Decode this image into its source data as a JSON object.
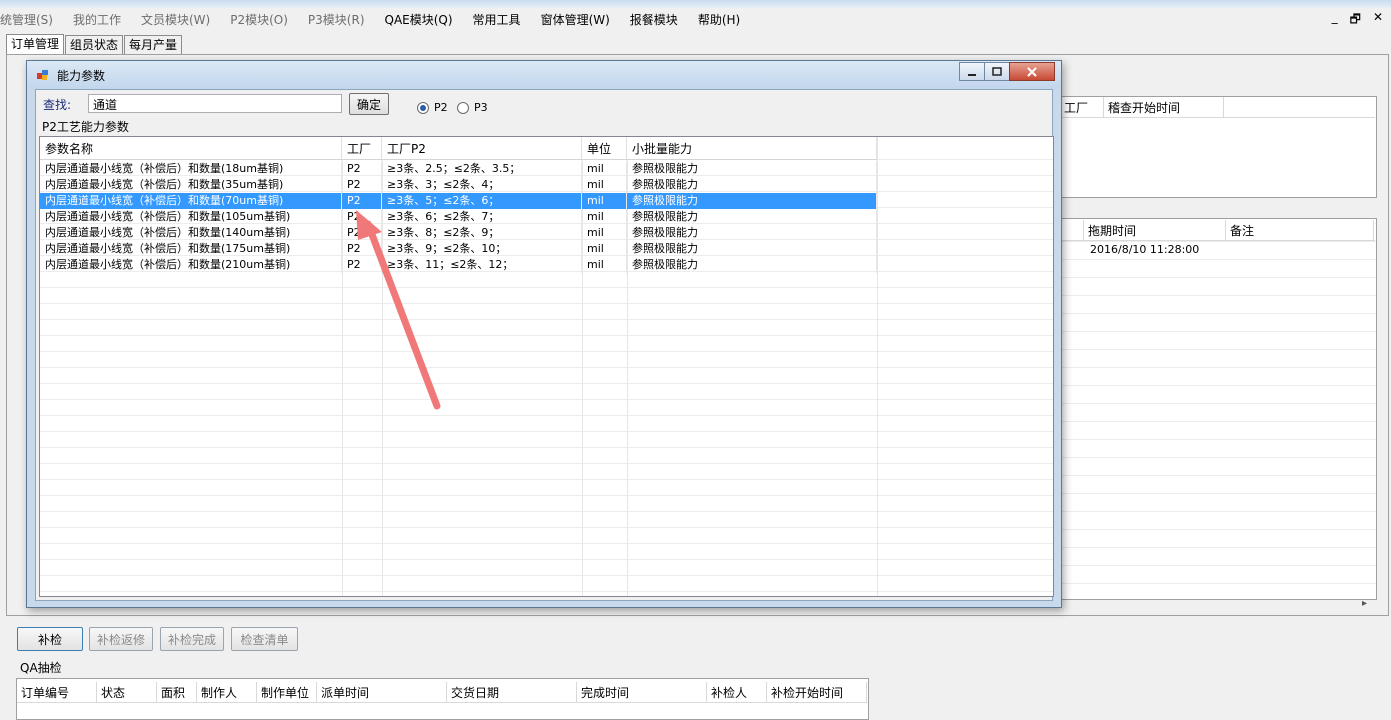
{
  "menu": {
    "items": [
      {
        "label": "统管理(S)",
        "disabled": true
      },
      {
        "label": "我的工作",
        "disabled": true
      },
      {
        "label": "文员模块(W)",
        "disabled": true
      },
      {
        "label": "P2模块(O)",
        "disabled": true
      },
      {
        "label": "P3模块(R)",
        "disabled": true
      },
      {
        "label": "QAE模块(Q)",
        "disabled": false
      },
      {
        "label": "常用工具",
        "disabled": false
      },
      {
        "label": "窗体管理(W)",
        "disabled": false
      },
      {
        "label": "报餐模块",
        "disabled": false
      },
      {
        "label": "帮助(H)",
        "disabled": false
      }
    ],
    "minimize_glyph": "_",
    "restore_glyph": "🗗",
    "close_glyph": "✕"
  },
  "tabs": [
    "订单管理",
    "组员状态",
    "每月产量"
  ],
  "background": {
    "top_grid_headers": [
      "工厂",
      "稽查开始时间"
    ],
    "middle_grid_headers": [
      "拖期时间",
      "备注"
    ],
    "middle_grid_row": {
      "delay_time": "2016/8/10 11:28:00"
    },
    "buttons": {
      "recheck": "补检",
      "recheck_repair": "补检返修",
      "recheck_done": "补检完成",
      "check_list": "检查清单"
    },
    "qa_label": "QA抽检",
    "qa_headers": [
      "订单编号",
      "状态",
      "面积",
      "制作人",
      "制作单位",
      "派单时间",
      "交货日期",
      "完成时间",
      "补检人",
      "补检开始时间"
    ],
    "scroll_right_glyph": "▸"
  },
  "dialog": {
    "title": "能力参数",
    "search_label": "查找:",
    "search_value": "通道",
    "ok_label": "确定",
    "radio_p2": "P2",
    "radio_p3": "P3",
    "selected_radio": "P2",
    "group_label": "P2工艺能力参数",
    "columns": [
      "参数名称",
      "工厂",
      "工厂P2",
      "单位",
      "小批量能力"
    ],
    "rows": [
      {
        "name": "内层通道最小线宽（补偿后）和数量(18um基铜)",
        "factory": "P2",
        "p2": "≥3条、2.5；≤2条、3.5；",
        "unit": "mil",
        "small": "参照极限能力"
      },
      {
        "name": "内层通道最小线宽（补偿后）和数量(35um基铜)",
        "factory": "P2",
        "p2": "≥3条、3；≤2条、4；",
        "unit": "mil",
        "small": "参照极限能力"
      },
      {
        "name": "内层通道最小线宽（补偿后）和数量(70um基铜)",
        "factory": "P2",
        "p2": "≥3条、5；≤2条、6；",
        "unit": "mil",
        "small": "参照极限能力"
      },
      {
        "name": "内层通道最小线宽（补偿后）和数量(105um基铜)",
        "factory": "P2",
        "p2": "≥3条、6；≤2条、7；",
        "unit": "mil",
        "small": "参照极限能力"
      },
      {
        "name": "内层通道最小线宽（补偿后）和数量(140um基铜)",
        "factory": "P2",
        "p2": "≥3条、8；≤2条、9；",
        "unit": "mil",
        "small": "参照极限能力"
      },
      {
        "name": "内层通道最小线宽（补偿后）和数量(175um基铜)",
        "factory": "P2",
        "p2": "≥3条、9；≤2条、10；",
        "unit": "mil",
        "small": "参照极限能力"
      },
      {
        "name": "内层通道最小线宽（补偿后）和数量(210um基铜)",
        "factory": "P2",
        "p2": "≥3条、11；≤2条、12；",
        "unit": "mil",
        "small": "参照极限能力"
      }
    ],
    "selected_row": 2,
    "annotation_color": "#f07878"
  }
}
